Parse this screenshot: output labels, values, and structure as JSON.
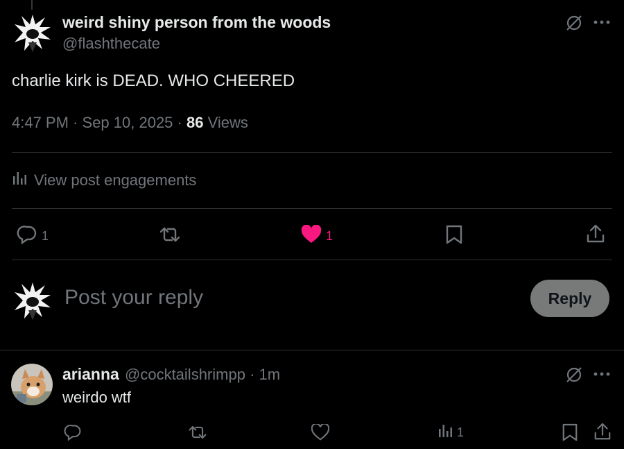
{
  "colors": {
    "background": "#000000",
    "text_primary": "#e7e9ea",
    "text_secondary": "#71767b",
    "like": "#f91880",
    "divider": "#2f3336",
    "reply_button_bg": "#787a7a"
  },
  "post": {
    "author_name": "weird shiny person from the woods",
    "author_handle": "@flashthecate",
    "text": "charlie kirk is DEAD. WHO CHEERED",
    "time": "4:47 PM",
    "date": "Sep 10, 2025",
    "separator": "·",
    "views_count": "86",
    "views_label": "Views",
    "engagements_label": "View post engagements",
    "actions": {
      "reply_count": "1",
      "repost_count": "",
      "like_count": "1",
      "liked": true
    },
    "icons": [
      "grok-icon",
      "more-icon",
      "reply-icon",
      "repost-icon",
      "heart-filled-icon",
      "bookmark-icon",
      "share-icon",
      "analytics-icon"
    ]
  },
  "composer": {
    "placeholder": "Post your reply",
    "button_label": "Reply"
  },
  "replies": [
    {
      "author_name": "arianna",
      "author_handle": "@cocktailshrimpp",
      "time": "1m",
      "text": "weirdo wtf",
      "views_count": "1"
    }
  ]
}
